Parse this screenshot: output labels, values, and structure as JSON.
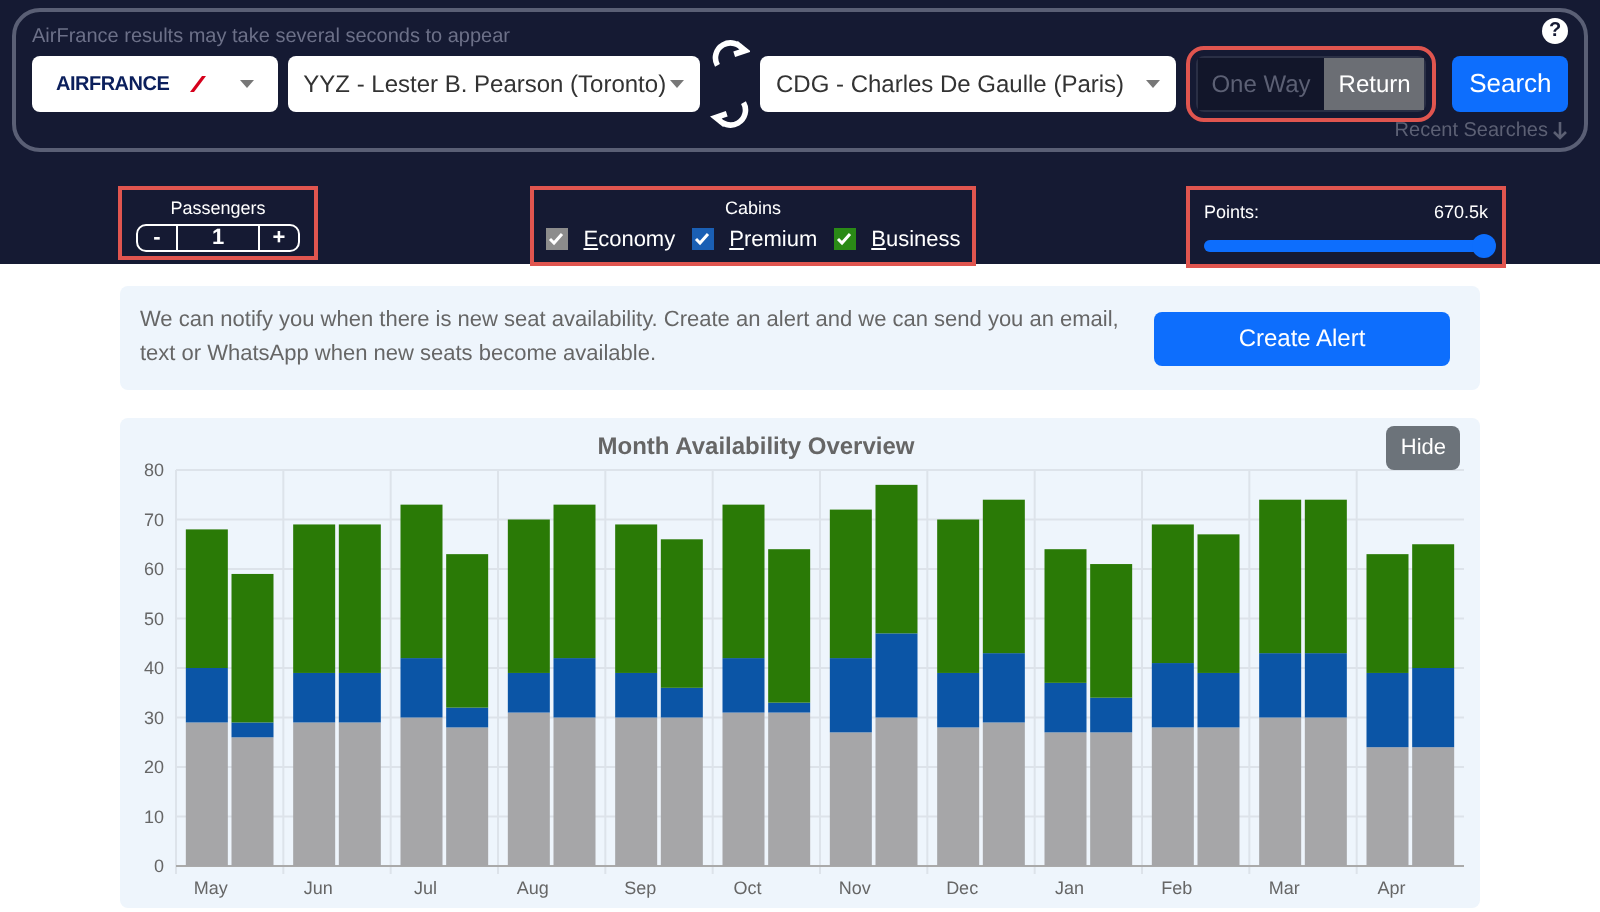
{
  "notice": "AirFrance results may take several seconds to appear",
  "airline": {
    "logo": "AIRFRANCE"
  },
  "origin": {
    "value": "YYZ - Lester B. Pearson (Toronto)"
  },
  "destination": {
    "value": "CDG - Charles De Gaulle (Paris)"
  },
  "trip_type": [
    {
      "label": "One Way",
      "selected": false
    },
    {
      "label": "Return",
      "selected": true
    }
  ],
  "search_button": "Search",
  "recent_searches": "Recent Searches",
  "help": "?",
  "passengers": {
    "label": "Passengers",
    "minus": "-",
    "count": "1",
    "plus": "+"
  },
  "cabins": {
    "label": "Cabins",
    "items": [
      {
        "label": "Economy",
        "checked": true,
        "color": "#8c8c8c"
      },
      {
        "label": "Premium",
        "checked": true,
        "color": "#1a5fb4"
      },
      {
        "label": "Business",
        "checked": true,
        "color": "#2a8a16"
      }
    ]
  },
  "points": {
    "label": "Points:",
    "reading": "670.5k",
    "level": 1
  },
  "alert": {
    "text": "We can notify you when there is new seat availability. Create an alert and we can send you an email, text or WhatsApp when new seats become available.",
    "button": "Create Alert"
  },
  "chart_panel": {
    "hide_button": "Hide",
    "chart_data": {
      "type": "bar",
      "title": "Month Availability Overview",
      "stacked": true,
      "grid": true,
      "categories": [
        "May",
        null,
        "Jun",
        null,
        "Jul",
        null,
        "Aug",
        null,
        "Sep",
        null,
        "Oct",
        null,
        "Nov",
        null,
        "Dec",
        null,
        "Jan",
        null,
        "Feb",
        null,
        "Mar",
        null,
        "Apr",
        null
      ],
      "ylim": [
        0,
        80
      ],
      "yticks": [
        0,
        10,
        20,
        30,
        40,
        50,
        60,
        70,
        80
      ],
      "series": [
        {
          "color": "#a6a6a8",
          "values": [
            29,
            26,
            29,
            29,
            30,
            28,
            31,
            30,
            30,
            30,
            31,
            31,
            27,
            30,
            28,
            29,
            27,
            27,
            28,
            28,
            30,
            30,
            24,
            24
          ]
        },
        {
          "color": "#0b55a6",
          "values": [
            11,
            3,
            10,
            10,
            12,
            4,
            8,
            12,
            9,
            6,
            11,
            2,
            15,
            17,
            11,
            14,
            10,
            7,
            13,
            11,
            13,
            13,
            15,
            16
          ]
        },
        {
          "color": "#2a7a06",
          "values": [
            28,
            30,
            30,
            30,
            31,
            31,
            31,
            31,
            30,
            30,
            31,
            31,
            30,
            30,
            31,
            31,
            27,
            27,
            28,
            28,
            31,
            31,
            24,
            25
          ]
        }
      ]
    }
  }
}
